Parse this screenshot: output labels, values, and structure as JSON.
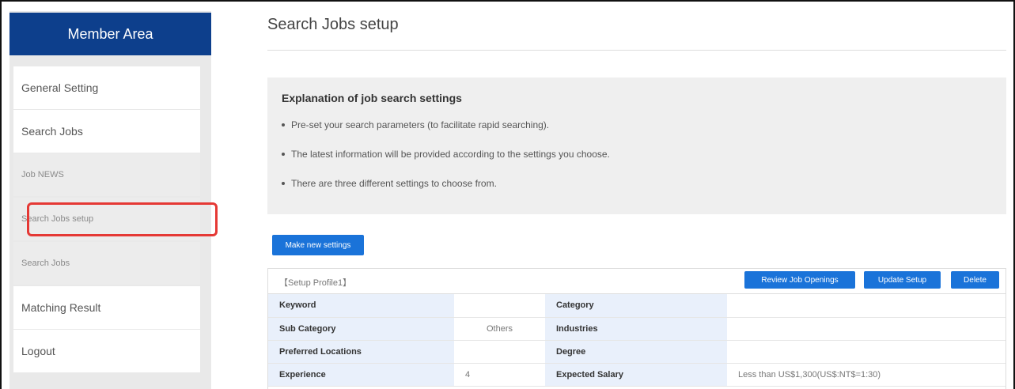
{
  "sidebar": {
    "header": "Member Area",
    "items": [
      {
        "label": "General Setting"
      },
      {
        "label": "Search Jobs"
      },
      {
        "label": "Job NEWS"
      },
      {
        "label": "Search Jobs setup"
      },
      {
        "label": "Search Jobs"
      },
      {
        "label": "Matching Result"
      },
      {
        "label": "Logout"
      }
    ],
    "highlight_color": "#e53935"
  },
  "main": {
    "title": "Search Jobs setup",
    "explanation": {
      "heading": "Explanation of job search settings",
      "bullets": [
        "Pre-set your search parameters (to facilitate rapid searching).",
        "The latest information will be provided according to the settings you choose.",
        "There are three different settings to choose from."
      ]
    },
    "new_settings_button": "Make new settings",
    "profile": {
      "label": "【Setup Profile1】",
      "buttons": {
        "review": "Review Job Openings",
        "update": "Update Setup",
        "delete": "Delete"
      },
      "rows": [
        {
          "l1": "Keyword",
          "v1": "",
          "l2": "Category",
          "v2": ""
        },
        {
          "l1": "Sub Category",
          "v1": "Others",
          "l2": "Industries",
          "v2": ""
        },
        {
          "l1": "Preferred Locations",
          "v1": "",
          "l2": "Degree",
          "v2": ""
        },
        {
          "l1": "Experience",
          "v1": "4",
          "l2": "Expected Salary",
          "v2": "Less than US$1,300(US$:NT$=1:30)"
        }
      ]
    }
  },
  "colors": {
    "brand": "#0d3f8c",
    "button": "#1a73d9",
    "label_bg": "#e9f0fb"
  }
}
